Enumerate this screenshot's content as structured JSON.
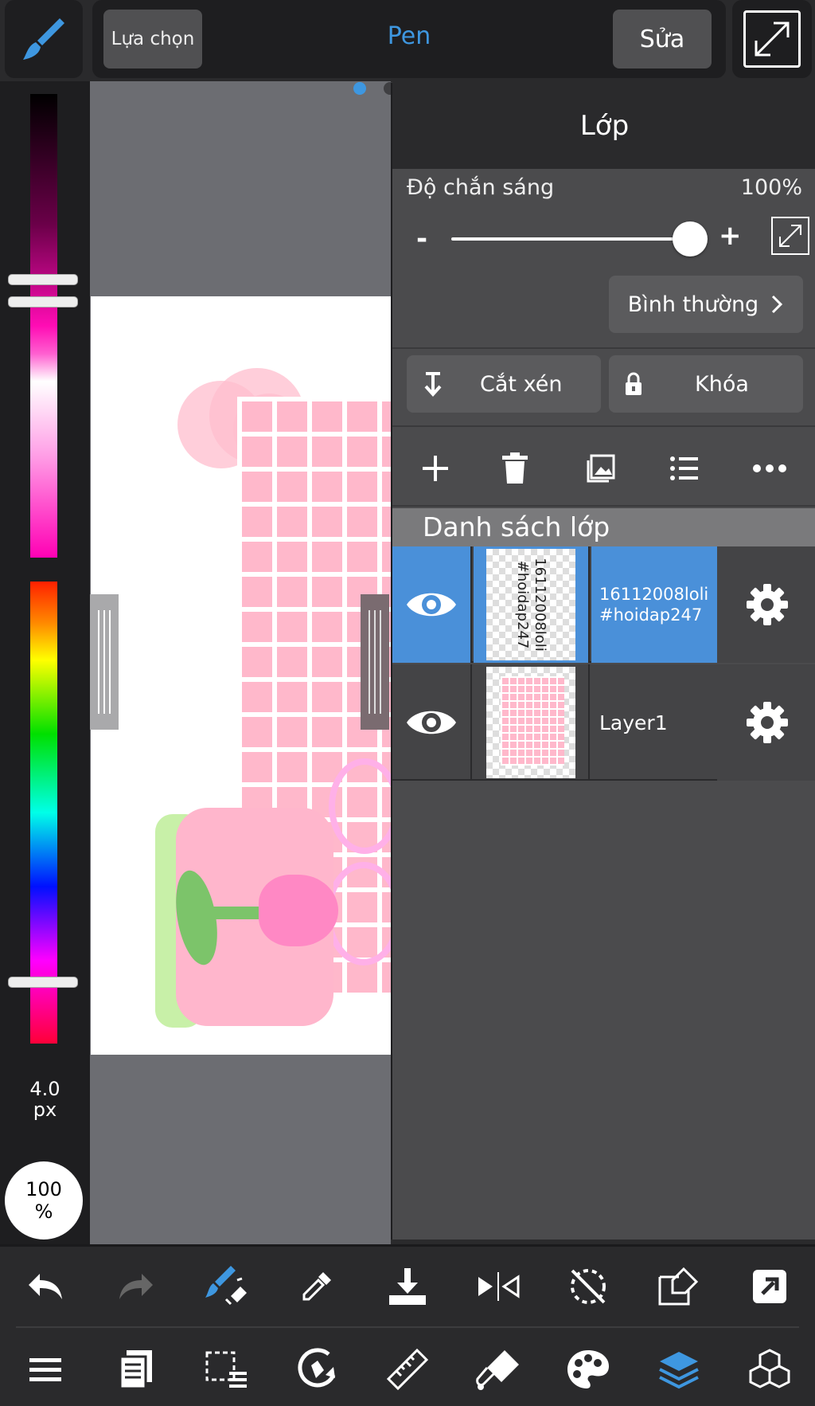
{
  "topbar": {
    "selection_label": "Lựa chọn",
    "tool_name": "Pen",
    "edit_label": "Sửa"
  },
  "left_panel": {
    "brush_size_value": "4.0",
    "brush_size_unit": "px",
    "opacity_value": "100",
    "opacity_unit": "%"
  },
  "layers_panel": {
    "title": "Lớp",
    "opacity_label": "Độ chắn sáng",
    "opacity_value": "100%",
    "opacity_level": 1.0,
    "minus_label": "-",
    "plus_label": "+",
    "blend_mode": "Bình thường",
    "clipping_label": "Cắt xén",
    "lock_label": "Khóa",
    "list_header": "Danh sách lớp",
    "layers": [
      {
        "name": "16112008loli\n#hoidap247",
        "thumb_text": "16112008loli\n#hoidap247",
        "selected": true
      },
      {
        "name": "Layer1",
        "selected": false
      }
    ]
  },
  "colors": {
    "accent": "#3e97e0",
    "selected_layer": "#4a90d9",
    "panel_bg": "#4b4b4d",
    "toolbar_bg": "#2a2a2c"
  },
  "icons": {
    "top": [
      "brush-icon",
      "expand-icon"
    ],
    "layer_tools": [
      "add-layer-icon",
      "delete-layer-icon",
      "image-layer-icon",
      "layer-list-icon",
      "more-icon"
    ],
    "bottom_row1": [
      "undo-icon",
      "redo-icon",
      "brush-eraser-switch-icon",
      "eyedropper-icon",
      "download-icon",
      "flip-icon",
      "rotate-off-icon",
      "transform-icon",
      "share-icon"
    ],
    "bottom_row2": [
      "menu-icon",
      "pages-icon",
      "selection-icon",
      "rotate-canvas-icon",
      "ruler-icon",
      "fill-icon",
      "palette-icon",
      "layers-icon",
      "materials-icon"
    ]
  }
}
